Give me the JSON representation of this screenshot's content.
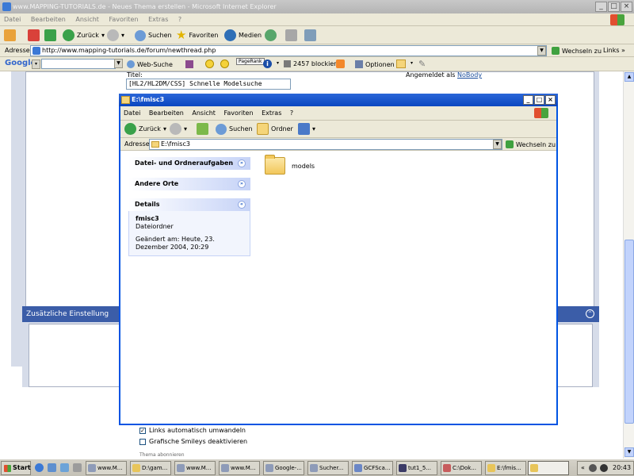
{
  "ie": {
    "title": "www.MAPPING-TUTORIALS.de - Neues Thema erstellen - Microsoft Internet Explorer",
    "menu": [
      "Datei",
      "Bearbeiten",
      "Ansicht",
      "Favoriten",
      "Extras",
      "?"
    ],
    "toolbar": {
      "back": "Zurück",
      "search": "Suchen",
      "favorites": "Favoriten",
      "media": "Medien"
    },
    "address_label": "Adresse",
    "url": "http://www.mapping-tutorials.de/forum/newthread.php",
    "go": "Wechseln zu",
    "links": "Links"
  },
  "google_bar": {
    "brand": "Google",
    "web_search": "Web-Suche",
    "pagerank": "PageRank",
    "blocked": "2457 blockiert",
    "options": "Optionen"
  },
  "page": {
    "title_label": "Titel:",
    "title_value": "[HL2/HL2DM/CSS] Schnelle Modelsuche",
    "logged_in_label": "Angemeldet als",
    "logged_in_user": "NoBody",
    "extra_header": "Zusätzliche Einstellung",
    "checkbox1": "Links automatisch umwandeln",
    "checkbox2": "Grafische Smileys deaktivieren",
    "subscribe": "Thema abonnieren"
  },
  "explorer": {
    "title": "E:\\fmisc3",
    "menu": [
      "Datei",
      "Bearbeiten",
      "Ansicht",
      "Favoriten",
      "Extras",
      "?"
    ],
    "toolbar": {
      "back": "Zurück",
      "search": "Suchen",
      "folders": "Ordner"
    },
    "address_label": "Adresse",
    "address": "E:\\fmisc3",
    "go": "Wechseln zu",
    "tasks": {
      "file_tasks": "Datei- und Ordneraufgaben",
      "other_places": "Andere Orte",
      "details": "Details",
      "detail_name": "fmisc3",
      "detail_type": "Dateiordner",
      "detail_modified": "Geändert am: Heute, 23. Dezember 2004, 20:29"
    },
    "folder_name": "models"
  },
  "taskbar": {
    "start": "Start",
    "items": [
      "www.M...",
      "D:\\gam...",
      "www.M...",
      "www.M...",
      "Google-...",
      "Sucher...",
      "GCFSca...",
      "tut1_5...",
      "C:\\Dok...",
      "E:\\fmis..."
    ],
    "time": "20:43"
  }
}
